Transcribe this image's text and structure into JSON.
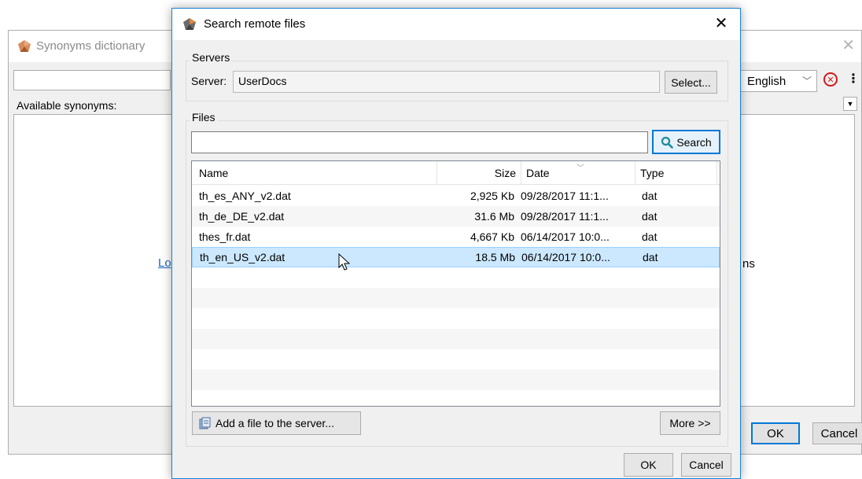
{
  "background_window": {
    "title": "Synonyms dictionary",
    "available_label": "Available synonyms:",
    "link_text": "Lo",
    "right_text": "ns",
    "language": "English",
    "ok_label": "OK",
    "cancel_label": "Cancel"
  },
  "dialog": {
    "title": "Search remote files",
    "servers_group_label": "Servers",
    "server_label": "Server:",
    "server_value": "UserDocs",
    "select_button": "Select...",
    "files_group_label": "Files",
    "search_value": "",
    "search_button": "Search",
    "columns": {
      "name": "Name",
      "size": "Size",
      "date": "Date",
      "type": "Type"
    },
    "files": [
      {
        "name": "th_es_ANY_v2.dat",
        "size": "2,925 Kb",
        "date": "09/28/2017 11:1...",
        "type": "dat"
      },
      {
        "name": "th_de_DE_v2.dat",
        "size": "31.6 Mb",
        "date": "09/28/2017 11:1...",
        "type": "dat"
      },
      {
        "name": "thes_fr.dat",
        "size": "4,667 Kb",
        "date": "06/14/2017 10:0...",
        "type": "dat"
      },
      {
        "name": "th_en_US_v2.dat",
        "size": "18.5 Mb",
        "date": "06/14/2017 10:0...",
        "type": "dat"
      }
    ],
    "add_file_button": "Add a file to the server...",
    "more_button": "More >>",
    "ok_label": "OK",
    "cancel_label": "Cancel"
  },
  "colors": {
    "accent": "#0078d7",
    "selection": "#cce8ff",
    "link": "#1a66c2",
    "error": "#d31818"
  }
}
